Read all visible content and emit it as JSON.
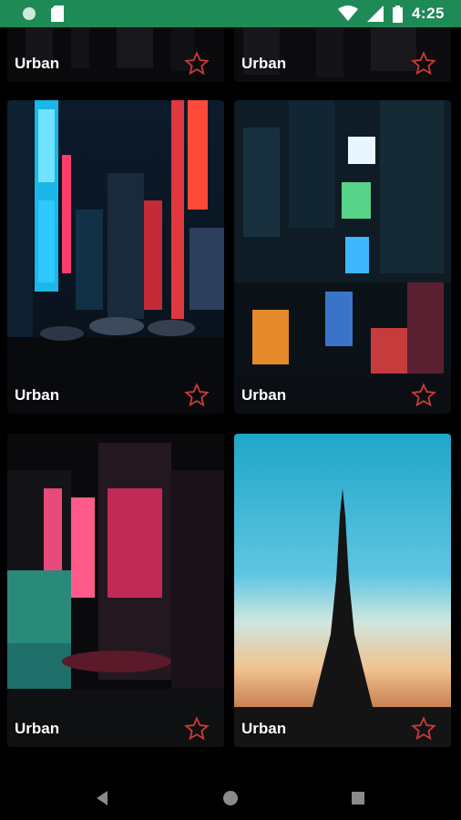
{
  "status_bar": {
    "time": "4:25",
    "icons": [
      "status-circle-icon",
      "sd-card-icon",
      "wifi-icon",
      "signal-icon",
      "battery-icon"
    ]
  },
  "gallery": {
    "cards": [
      {
        "label": "Urban",
        "scene": "dark-city-street-top"
      },
      {
        "label": "Urban",
        "scene": "dark-city-top-right"
      },
      {
        "label": "Urban",
        "scene": "tokyo-neon-street"
      },
      {
        "label": "Urban",
        "scene": "times-square-aerial"
      },
      {
        "label": "Urban",
        "scene": "hong-kong-neon-night"
      },
      {
        "label": "Urban",
        "scene": "eiffel-tower-sunset"
      }
    ],
    "favorite_icon": "star-outline-icon"
  },
  "navigation_bar": {
    "buttons": [
      "back-icon",
      "home-icon",
      "recents-icon"
    ]
  },
  "colors": {
    "status_bar": "#1e8a55",
    "star_outline": "#d23a3a",
    "background": "#000000"
  }
}
